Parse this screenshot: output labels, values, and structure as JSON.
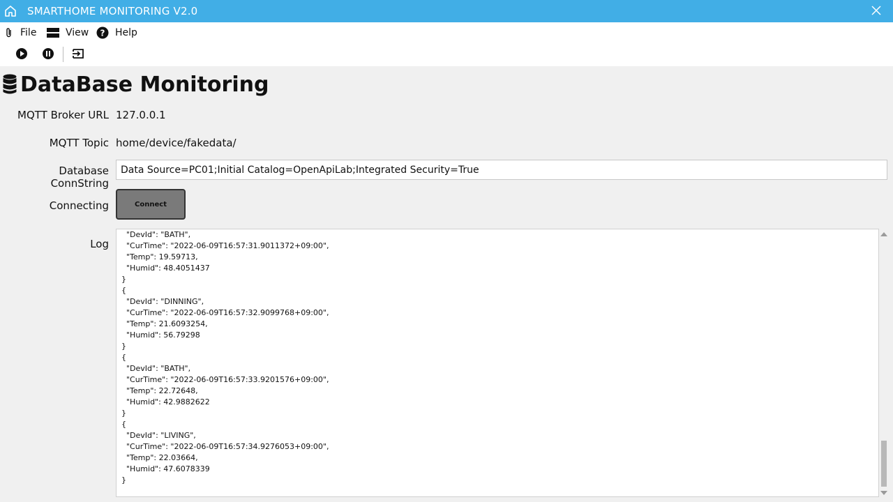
{
  "window": {
    "title": "SMARTHOME MONITORING V2.0"
  },
  "menu": {
    "file": "File",
    "view": "View",
    "help": "Help"
  },
  "toolbar": {
    "icons": [
      "play-icon",
      "pause-icon",
      "exit-icon"
    ]
  },
  "header": {
    "title": "DataBase Monitoring",
    "icon": "database-icon"
  },
  "form": {
    "broker_label": "MQTT Broker URL",
    "broker_value": "127.0.0.1",
    "topic_label": "MQTT Topic",
    "topic_value": "home/device/fakedata/",
    "conn_label": "Database ConnString",
    "conn_value": "Data Source=PC01;Initial Catalog=OpenApiLab;Integrated Security=True",
    "connecting_label": "Connecting",
    "connect_button": "Connect",
    "log_label": "Log"
  },
  "log": {
    "lines": [
      "  \"DevId\": \"BATH\",",
      "  \"CurTime\": \"2022-06-09T16:57:31.9011372+09:00\",",
      "  \"Temp\": 19.59713,",
      "  \"Humid\": 48.4051437",
      "}",
      "{",
      "  \"DevId\": \"DINNING\",",
      "  \"CurTime\": \"2022-06-09T16:57:32.9099768+09:00\",",
      "  \"Temp\": 21.6093254,",
      "  \"Humid\": 56.79298",
      "}",
      "{",
      "  \"DevId\": \"BATH\",",
      "  \"CurTime\": \"2022-06-09T16:57:33.9201576+09:00\",",
      "  \"Temp\": 22.72648,",
      "  \"Humid\": 42.9882622",
      "}",
      "{",
      "  \"DevId\": \"LIVING\",",
      "  \"CurTime\": \"2022-06-09T16:57:34.9276053+09:00\",",
      "  \"Temp\": 22.03664,",
      "  \"Humid\": 47.6078339",
      "}"
    ]
  },
  "colors": {
    "titlebar": "#41aee6",
    "button": "#7a7a7a"
  }
}
